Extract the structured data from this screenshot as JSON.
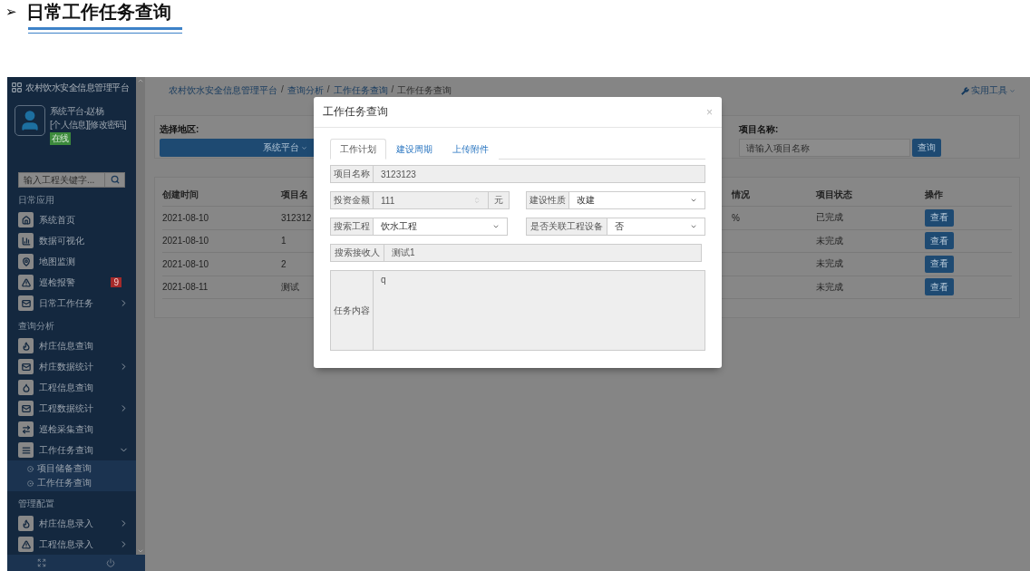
{
  "heading": {
    "marker": "➢",
    "title": "日常工作任务查询"
  },
  "sidebar": {
    "title": "农村饮水安全信息管理平台",
    "user": {
      "name": "系统平台-赵杨",
      "links": [
        "[个人信息]",
        "[修改密码]"
      ],
      "status": "在线"
    },
    "search": {
      "placeholder": "输入工程关键字..."
    },
    "sections": [
      {
        "title": "日常应用",
        "items": [
          {
            "label": "系统首页"
          },
          {
            "label": "数据可视化"
          },
          {
            "label": "地图监测"
          },
          {
            "label": "巡检报警",
            "badge": "9"
          },
          {
            "label": "日常工作任务",
            "expanded": false
          }
        ]
      },
      {
        "title": "查询分析",
        "items": [
          {
            "label": "村庄信息查询"
          },
          {
            "label": "村庄数据统计",
            "expanded": false
          },
          {
            "label": "工程信息查询"
          },
          {
            "label": "工程数据统计",
            "expanded": false
          },
          {
            "label": "巡检采集查询"
          },
          {
            "label": "工作任务查询",
            "expanded": true,
            "children": [
              {
                "label": "项目储备查询"
              },
              {
                "label": "工作任务查询"
              }
            ]
          }
        ]
      },
      {
        "title": "管理配置",
        "items": [
          {
            "label": "村庄信息录入",
            "expanded": false
          },
          {
            "label": "工程信息录入",
            "expanded": false
          }
        ]
      }
    ]
  },
  "breadcrumb": {
    "separator": "/",
    "items": [
      "农村饮水安全信息管理平台",
      "查询分析",
      "工作任务查询",
      "工作任务查询"
    ]
  },
  "tools_menu": "实用工具",
  "filter": {
    "region_label": "选择地区:",
    "region_value": "系统平台",
    "project_label": "项目名称:",
    "project_placeholder": "请输入项目名称",
    "search_button": "查询"
  },
  "table": {
    "columns": [
      "创建时间",
      "项目名",
      "情况",
      "项目状态",
      "操作"
    ],
    "rows": [
      {
        "created": "2021-08-10",
        "name": "312312",
        "column_3": "%",
        "status": "已完成",
        "action": "查看"
      },
      {
        "created": "2021-08-10",
        "name": "1",
        "status": "未完成",
        "action": "查看"
      },
      {
        "created": "2021-08-10",
        "name": "2",
        "status": "未完成",
        "action": "查看"
      },
      {
        "created": "2021-08-11",
        "name": "测试",
        "status": "未完成",
        "action": "查看"
      }
    ]
  },
  "modal": {
    "title": "工作任务查询",
    "close": "×",
    "tabs": [
      {
        "label": "工作计划",
        "selected": true
      },
      {
        "label": "建设周期",
        "selected": false
      },
      {
        "label": "上传附件",
        "selected": false
      }
    ],
    "project_name": {
      "label": "项目名称",
      "value": "3123123"
    },
    "investment": {
      "label": "投资金额",
      "value": "111",
      "unit": "元"
    },
    "build_type": {
      "label": "建设性质",
      "value": "改建"
    },
    "project": {
      "label": "搜索工程",
      "value": "饮水工程"
    },
    "linked_device": {
      "label": "是否关联工程设备",
      "value": "否"
    },
    "receiver": {
      "label": "搜索接收人",
      "value": "测试1"
    },
    "content": {
      "label": "任务内容",
      "value": "q"
    }
  }
}
